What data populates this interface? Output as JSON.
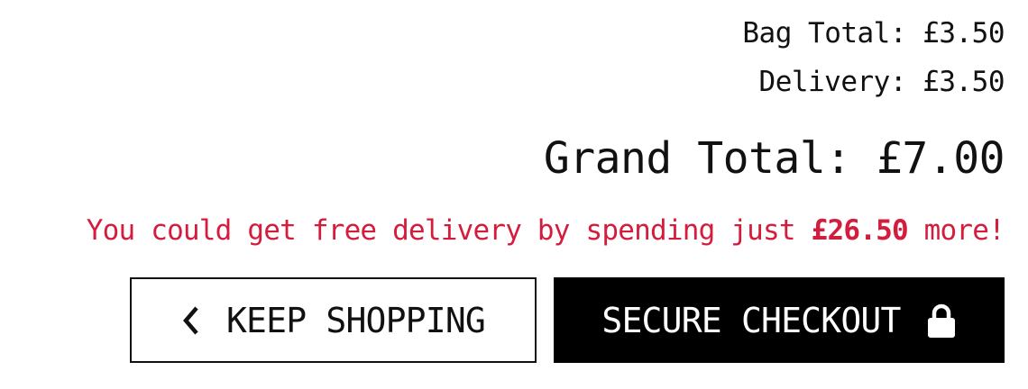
{
  "summary": {
    "bag_total": "Bag Total: £3.50",
    "delivery": "Delivery: £3.50",
    "grand_total": "Grand Total: £7.00"
  },
  "free_delivery": {
    "prefix": "You could get free delivery by spending just ",
    "amount": "£26.50",
    "suffix": " more!"
  },
  "buttons": {
    "keep_shopping": "KEEP SHOPPING",
    "secure_checkout": "SECURE CHECKOUT"
  },
  "icons": {
    "back": "chevron-left-icon",
    "checkout": "lock-icon"
  },
  "colors": {
    "accent_red": "#d41d3c",
    "text": "#111111",
    "checkout_bg": "#000000",
    "checkout_text": "#ffffff"
  }
}
